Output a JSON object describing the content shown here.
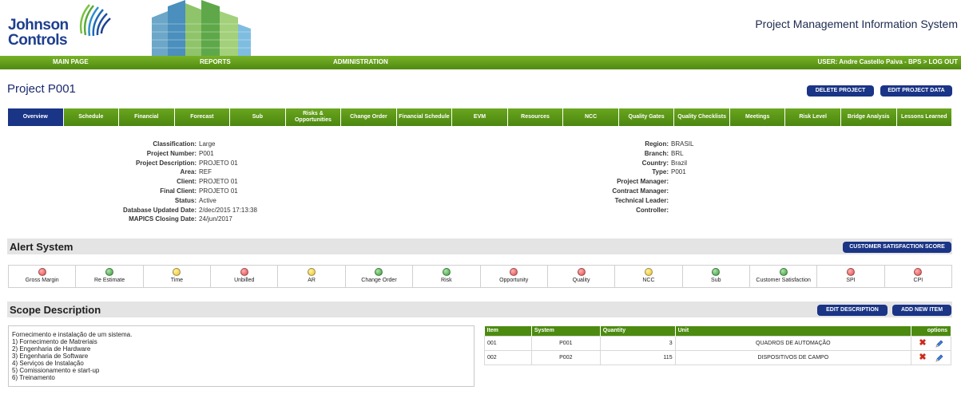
{
  "header": {
    "logo_line1": "Johnson",
    "logo_line2": "Controls",
    "system_title": "Project Management Information System"
  },
  "nav": {
    "items": [
      "MAIN PAGE",
      "REPORTS",
      "ADMINISTRATION"
    ],
    "user_text": "USER: Andre Castello Paiva - BPS > LOG OUT"
  },
  "project": {
    "title": "Project P001",
    "delete_label": "DELETE PROJECT",
    "edit_label": "EDIT PROJECT DATA"
  },
  "tabs": [
    {
      "label": "Overview",
      "active": true
    },
    {
      "label": "Schedule"
    },
    {
      "label": "Financial"
    },
    {
      "label": "Forecast"
    },
    {
      "label": "Sub"
    },
    {
      "label": "Risks & Opportunities"
    },
    {
      "label": "Change Order"
    },
    {
      "label": "Financial Schedule"
    },
    {
      "label": "EVM"
    },
    {
      "label": "Resources"
    },
    {
      "label": "NCC"
    },
    {
      "label": "Quality Gates"
    },
    {
      "label": "Quality Checklists"
    },
    {
      "label": "Meetings"
    },
    {
      "label": "Risk Level"
    },
    {
      "label": "Bridge Analysis"
    },
    {
      "label": "Lessons Learned"
    }
  ],
  "info_left": [
    {
      "label": "Classification:",
      "value": "Large"
    },
    {
      "label": "Project Number:",
      "value": "P001"
    },
    {
      "label": "Project Description:",
      "value": "PROJETO 01"
    },
    {
      "label": "Area:",
      "value": "REF"
    },
    {
      "label": "Client:",
      "value": "PROJETO 01"
    },
    {
      "label": "Final Client:",
      "value": "PROJETO 01"
    },
    {
      "label": "Status:",
      "value": "Active"
    },
    {
      "label": "Database Updated Date:",
      "value": "2/dec/2015 17:13:38"
    },
    {
      "label": "MAPICS Closing Date:",
      "value": "24/jun/2017"
    }
  ],
  "info_right": [
    {
      "label": "Region:",
      "value": "BRASIL"
    },
    {
      "label": "Branch:",
      "value": "BRL"
    },
    {
      "label": "Country:",
      "value": "Brazil"
    },
    {
      "label": "Type:",
      "value": "P001"
    },
    {
      "label": "Project Manager:",
      "value": ""
    },
    {
      "label": "Contract Manager:",
      "value": ""
    },
    {
      "label": "Technical Leader:",
      "value": ""
    },
    {
      "label": "Controller:",
      "value": ""
    }
  ],
  "alert_system": {
    "title": "Alert System",
    "button_label": "CUSTOMER SATISFACTION SCORE",
    "alerts": [
      {
        "label": "Gross Margin",
        "status": "red"
      },
      {
        "label": "Re Estimate",
        "status": "green"
      },
      {
        "label": "Time",
        "status": "yellow"
      },
      {
        "label": "Unbilled",
        "status": "red"
      },
      {
        "label": "AR",
        "status": "yellow"
      },
      {
        "label": "Change Order",
        "status": "green"
      },
      {
        "label": "Risk",
        "status": "green"
      },
      {
        "label": "Opportunity",
        "status": "red"
      },
      {
        "label": "Quality",
        "status": "red"
      },
      {
        "label": "NCC",
        "status": "yellow"
      },
      {
        "label": "Sub",
        "status": "green"
      },
      {
        "label": "Customer Satisfaction",
        "status": "green"
      },
      {
        "label": "SPI",
        "status": "red"
      },
      {
        "label": "CPI",
        "status": "red"
      }
    ]
  },
  "scope": {
    "title": "Scope Description",
    "edit_label": "EDIT DESCRIPTION",
    "add_label": "ADD NEW ITEM",
    "lines": [
      "Fornecimento e instalação de um sistema.",
      "1) Fornecimento de Matreriais",
      "2) Engenharia de Hardware",
      "3) Engenharia de Software",
      "4) Serviços de Instalação",
      "5) Comissionamento e start-up",
      "6) Treinamento"
    ]
  },
  "items_table": {
    "headers": [
      "Item",
      "System",
      "Quantity",
      "Unit",
      "options"
    ],
    "rows": [
      {
        "item": "001",
        "system": "P001",
        "quantity": "3",
        "unit": "QUADROS DE AUTOMAÇÃO"
      },
      {
        "item": "002",
        "system": "P002",
        "quantity": "115",
        "unit": "DISPOSITIVOS DE CAMPO"
      }
    ]
  },
  "colors": {
    "brand_blue": "#1a3486",
    "nav_green": "#4f8a10",
    "alert_red": "#e24848",
    "alert_green": "#3a9a3a",
    "alert_yellow": "#e6c030"
  }
}
